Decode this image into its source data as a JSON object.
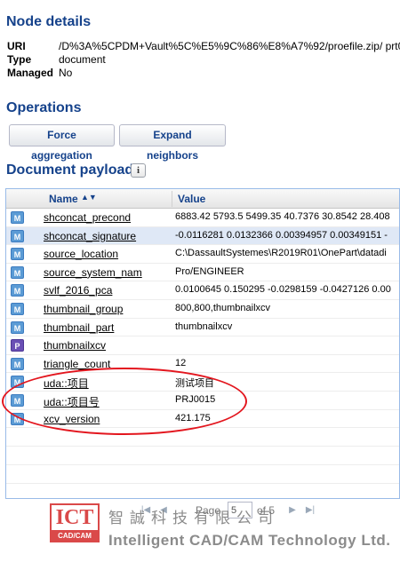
{
  "node_details": {
    "title": "Node details",
    "rows": [
      {
        "key": "URI",
        "value": "/D%3A%5CPDM+Vault%5C%E5%9C%86%E8%A7%92/proefile.zip/   prt0"
      },
      {
        "key": "Type",
        "value": "document"
      },
      {
        "key": "Managed",
        "value": "No"
      }
    ]
  },
  "operations": {
    "title": "Operations",
    "buttons": [
      "Force aggregation",
      "Expand neighbors"
    ]
  },
  "payload": {
    "title": "Document payload",
    "info_icon": "i",
    "columns": {
      "name": "Name",
      "value": "Value",
      "sort_icon": "▲▼"
    },
    "rows": [
      {
        "type": "M",
        "name": "shconcat_precond",
        "value": "6883.42 5793.5 5499.35 40.7376 30.8542 28.408"
      },
      {
        "type": "M",
        "name": "shconcat_signature",
        "value": "-0.0116281 0.0132366 0.00394957 0.00349151 -",
        "selected": true
      },
      {
        "type": "M",
        "name": "source_location",
        "value": "C:\\DassaultSystemes\\R2019R01\\OnePart\\datadi"
      },
      {
        "type": "M",
        "name": "source_system_nam",
        "value": "Pro/ENGINEER"
      },
      {
        "type": "M",
        "name": "svlf_2016_pca",
        "value": "0.0100645 0.150295 -0.0298159 -0.0427126 0.00"
      },
      {
        "type": "M",
        "name": "thumbnail_group",
        "value": "800,800,thumbnailxcv"
      },
      {
        "type": "M",
        "name": "thumbnail_part",
        "value": "thumbnailxcv"
      },
      {
        "type": "P",
        "name": "thumbnailxcv",
        "value": ""
      },
      {
        "type": "M",
        "name": "triangle_count",
        "value": "12"
      },
      {
        "type": "M",
        "name": "uda::项目",
        "value": "测试项目"
      },
      {
        "type": "M",
        "name": "uda::项目号",
        "value": "PRJ0015"
      },
      {
        "type": "M",
        "name": "xcv_version",
        "value": "421.175"
      }
    ]
  },
  "pager": {
    "first_icon": "|◀",
    "prev_icon": "◀",
    "page_label": "Page",
    "page_value": "5",
    "of_label": "of 5",
    "next_icon": "▶",
    "last_icon": "▶|"
  },
  "watermark": {
    "logo_top": "ICT",
    "logo_bottom": "CAD/CAM",
    "chinese": "智誠科技有限公司",
    "english": "Intelligent CAD/CAM Technology Ltd."
  },
  "colors": {
    "heading": "#15428b",
    "annotation": "#e3161e",
    "selected_row": "#dfe8f6"
  }
}
